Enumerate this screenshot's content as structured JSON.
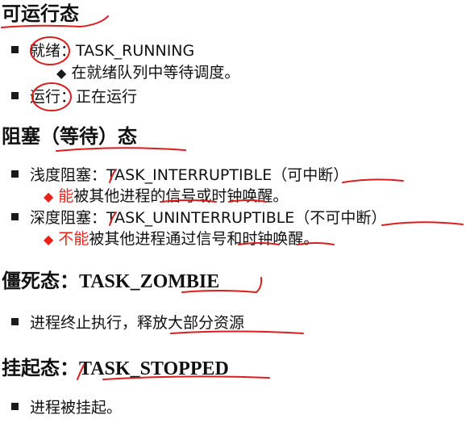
{
  "colors": {
    "text": "#111111",
    "accent_red": "#e8221b",
    "ink": "#d81e1e"
  },
  "sections": {
    "runnable": {
      "title": "可运行态",
      "ready_label": "就绪",
      "ready_value": "：TASK_RUNNING",
      "ready_sub": "在就绪队列中等待调度。",
      "running_label": "运行",
      "running_value": "：正在运行"
    },
    "blocked": {
      "title": "阻塞（等待）态",
      "light_label": "浅度阻塞",
      "light_value": "：TASK_INTERRUPTIBLE（可中断）",
      "light_sub_red": "能",
      "light_sub_rest": "被其他进程的信号或时钟唤醒。",
      "deep_label": "深度阻塞",
      "deep_value": "：TASK_UNINTERRUPTIBLE（不可中断）",
      "deep_sub_red": "不能",
      "deep_sub_rest": "被其他进程通过信号和时钟唤醒。"
    },
    "zombie": {
      "title_cn": "僵死态：",
      "title_en": "TASK_ZOMBIE",
      "item": "进程终止执行，释放大部分资源"
    },
    "stopped": {
      "title_cn": "挂起态：",
      "title_en": "TASK_STOPPED",
      "item": "进程被挂起。"
    }
  }
}
